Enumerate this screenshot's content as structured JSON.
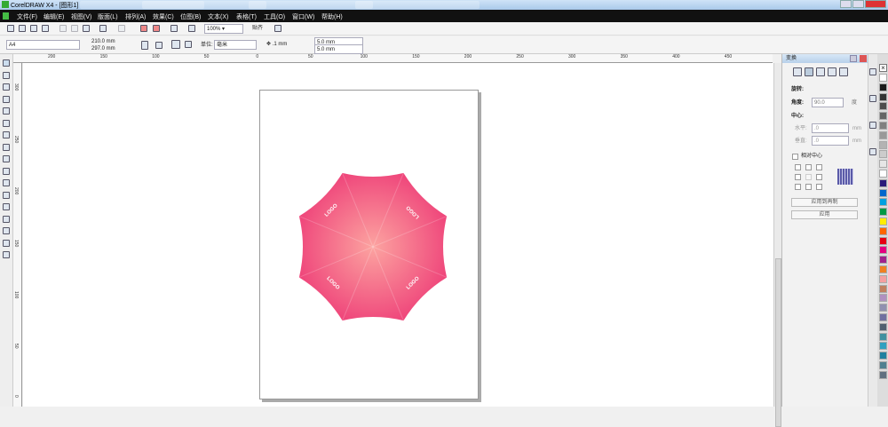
{
  "window": {
    "title": "CorelDRAW X4 - [图形1]"
  },
  "menu": [
    "文件(F)",
    "编辑(E)",
    "视图(V)",
    "版面(L)",
    "排列(A)",
    "效果(C)",
    "位图(B)",
    "文本(X)",
    "表格(T)",
    "工具(O)",
    "窗口(W)",
    "帮助(H)"
  ],
  "toolbar": {
    "zoom": "100%",
    "snap": "贴齐"
  },
  "propbar": {
    "page_size": "A4",
    "width": "210.0 mm",
    "height": "297.0 mm",
    "units_label": "单位:",
    "units": "毫米",
    "nudge": ".1 mm",
    "dup_x": "5.0 mm",
    "dup_y": "5.0 mm"
  },
  "ruler_top": [
    "200",
    "150",
    "100",
    "50",
    "0",
    "50",
    "100",
    "150",
    "200",
    "250",
    "300",
    "350",
    "400",
    "450"
  ],
  "ruler_left": [
    "300",
    "250",
    "200",
    "150",
    "100",
    "50",
    "0"
  ],
  "artwork": {
    "logos": [
      "LOGO",
      "LOGO",
      "LOGO",
      "LOGO"
    ],
    "fill_outer": "#ee3f78",
    "fill_center": "#fca3a0"
  },
  "docker": {
    "title": "变换",
    "section": "旋转:",
    "angle_label": "角度:",
    "angle": "90.0",
    "angle_unit": "度",
    "center_label": "中心:",
    "h_label": "水平:",
    "h_value": ".0",
    "h_unit": "mm",
    "v_label": "垂直:",
    "v_value": ".0",
    "v_unit": "mm",
    "relative_center": "相对中心",
    "apply_dup": "应用到再制",
    "apply": "应用"
  },
  "palette": [
    "#ffffff",
    "#1a1a1a",
    "#333333",
    "#4d4d4d",
    "#666666",
    "#808080",
    "#999999",
    "#b3b3b3",
    "#cccccc",
    "#e6e6e6",
    "#ffffff",
    "#2a1a7a",
    "#0066cc",
    "#00a0e0",
    "#009944",
    "#ffee00",
    "#ff6600",
    "#e60012",
    "#e4007f",
    "#a0228c",
    "#f08020",
    "#f4a0a0",
    "#c08060",
    "#b090c0",
    "#9090b0",
    "#7070a0",
    "#506070",
    "#4090a0",
    "#30a0c0",
    "#2080a0",
    "#508090",
    "#607080"
  ]
}
